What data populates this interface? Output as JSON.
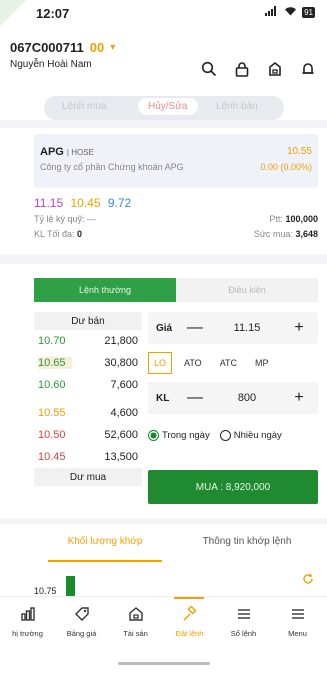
{
  "status_bar": {
    "time": "12:07",
    "battery": "91"
  },
  "account": {
    "number": "067C000711",
    "sub_account": "00",
    "name": "Nguyễn Hoài Nam"
  },
  "faded_tabs": [
    "Lệnh mua",
    "Hủy/Sửa",
    "Lệnh bán"
  ],
  "stock": {
    "code": "APG",
    "exchange": "| HOSE",
    "name": "Công ty cổ phần Chứng khoán APG",
    "price": "10.55",
    "change": "0.00 (0.00%)"
  },
  "prices": {
    "ceiling": "11.15",
    "reference": "10.45",
    "floor": "9.72"
  },
  "info": {
    "margin_label": "Tỷ lệ ký quỹ:",
    "margin_value": "—",
    "ptt_label": "Ptt:",
    "ptt_value": "100,000",
    "max_qty_label": "KL Tối đa:",
    "max_qty_value": "0",
    "buy_power_label": "Sức mua:",
    "buy_power_value": "3,648"
  },
  "order_tabs": [
    "Lệnh thường",
    "Điều kiện"
  ],
  "order_book": {
    "ask_header": "Dư bán",
    "asks": [
      {
        "price": "10.70",
        "volume": "21,800"
      },
      {
        "price": "10.65",
        "volume": "30,800"
      },
      {
        "price": "10.60",
        "volume": "7,600"
      }
    ],
    "bids": [
      {
        "price": "10.55",
        "volume": "4,600"
      },
      {
        "price": "10.50",
        "volume": "52,600"
      },
      {
        "price": "10.45",
        "volume": "13,500"
      }
    ],
    "bid_header": "Dư mua"
  },
  "form": {
    "price_label": "Giá",
    "price_value": "11.15",
    "minus": "—",
    "plus": "+",
    "types": [
      "LO",
      "ATO",
      "ATC",
      "MP"
    ],
    "qty_label": "KL",
    "qty_value": "800",
    "validity": [
      "Trong ngày",
      "Nhiều ngày"
    ],
    "buy_label": "MUA : 8,920,000"
  },
  "bottom_tabs": [
    "Khối lượng khớp",
    "Thông tin khớp lệnh"
  ],
  "volume_chart": {
    "price_label": "10.75"
  },
  "nav": [
    "hị trường",
    "Bảng giá",
    "Tài sản",
    "Đặt lệnh",
    "Số lệnh",
    "Menu"
  ],
  "colors": {
    "accent": "#f0a000",
    "buy_green": "#1f8a30",
    "ceiling": "#c040d0",
    "floor": "#2f8fd8"
  }
}
